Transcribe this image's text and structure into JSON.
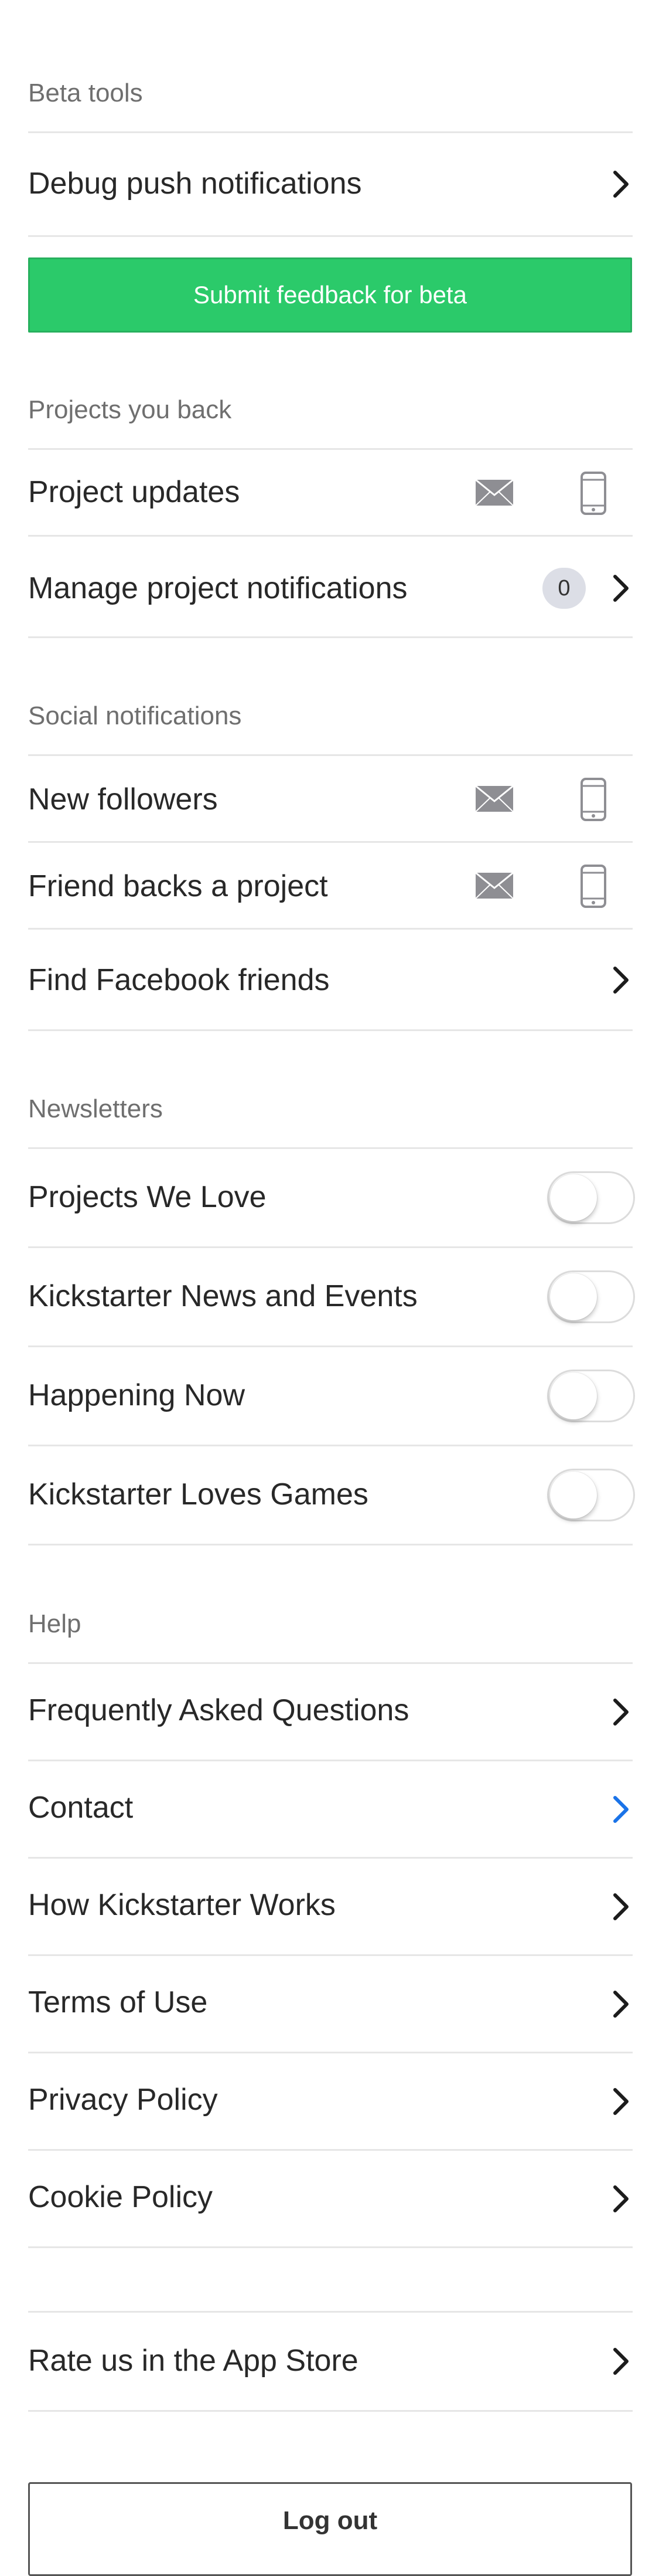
{
  "beta_tools": {
    "header": "Beta tools",
    "debug_push_label": "Debug push notifications",
    "submit_feedback_label": "Submit feedback for beta"
  },
  "projects_you_back": {
    "header": "Projects you back",
    "project_updates_label": "Project updates",
    "manage_notifications_label": "Manage project notifications",
    "manage_notifications_count": "0"
  },
  "social_notifications": {
    "header": "Social notifications",
    "new_followers_label": "New followers",
    "friend_backs_label": "Friend backs a project",
    "find_facebook_label": "Find Facebook friends"
  },
  "newsletters": {
    "header": "Newsletters",
    "items": [
      {
        "label": "Projects We Love",
        "enabled": false
      },
      {
        "label": "Kickstarter News and Events",
        "enabled": false
      },
      {
        "label": "Happening Now",
        "enabled": false
      },
      {
        "label": "Kickstarter Loves Games",
        "enabled": false
      }
    ]
  },
  "help": {
    "header": "Help",
    "items": [
      {
        "label": "Frequently Asked Questions"
      },
      {
        "label": "Contact"
      },
      {
        "label": "How Kickstarter Works"
      },
      {
        "label": "Terms of Use"
      },
      {
        "label": "Privacy Policy"
      },
      {
        "label": "Cookie Policy"
      }
    ]
  },
  "rate_app_label": "Rate us in the App Store",
  "logout_label": "Log out",
  "colors": {
    "accent_green": "#2bca6a",
    "link_blue": "#1a73e8",
    "icon_gray": "#8e8e93"
  },
  "icons": {
    "chevron": "chevron-right-icon",
    "email": "envelope-icon",
    "phone": "phone-icon"
  }
}
